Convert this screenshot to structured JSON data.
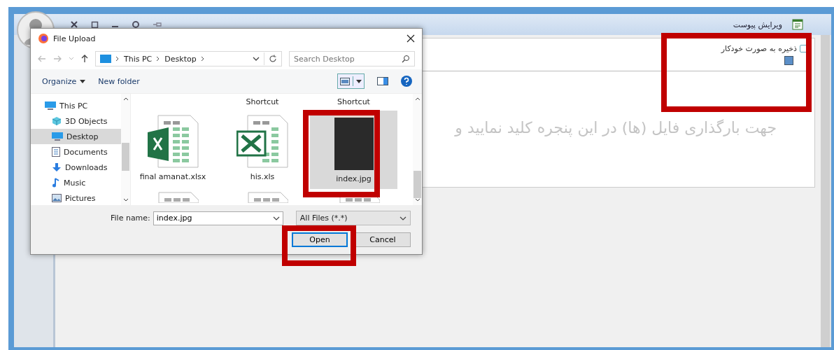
{
  "app": {
    "title": "ویرایش پیوست",
    "autosave": {
      "label": "ذخیره به صورت خودکار",
      "checked": false
    },
    "drop_hint": "جهت بارگذاری فایل (ها) در این پنجره کلید نمایید و"
  },
  "dialog": {
    "title": "File Upload",
    "breadcrumb": [
      "This PC",
      "Desktop"
    ],
    "search": {
      "placeholder": "Search Desktop"
    },
    "toolbar": [
      "Organize",
      "New folder"
    ],
    "nav": [
      {
        "label": "This PC",
        "kind": "pc",
        "selected": false
      },
      {
        "label": "3D Objects",
        "kind": "cube",
        "selected": false
      },
      {
        "label": "Desktop",
        "kind": "desktop",
        "selected": true
      },
      {
        "label": "Documents",
        "kind": "docs",
        "selected": false
      },
      {
        "label": "Downloads",
        "kind": "down",
        "selected": false
      },
      {
        "label": "Music",
        "kind": "music",
        "selected": false
      },
      {
        "label": "Pictures",
        "kind": "pics",
        "selected": false
      }
    ],
    "partial_labels": [
      "Shortcut",
      "Shortcut"
    ],
    "files": [
      {
        "name": "final amanat.xlsx",
        "kind": "xlsx",
        "selected": false
      },
      {
        "name": "his.xls",
        "kind": "xls",
        "selected": false
      },
      {
        "name": "index.jpg",
        "kind": "photo",
        "selected": true
      }
    ],
    "file_name": {
      "label": "File name:",
      "value": "index.jpg"
    },
    "filter": "All Files (*.*)",
    "buttons": [
      "Open",
      "Cancel"
    ]
  }
}
